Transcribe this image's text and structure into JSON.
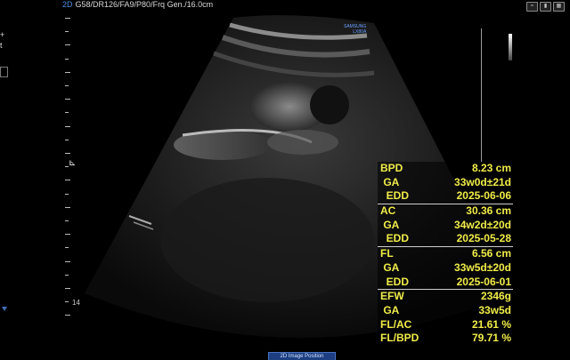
{
  "header": {
    "mode": "2D",
    "params": "G58/DR126/FA9/P80/Frq Gen./16.0cm"
  },
  "brand": {
    "line1": "SAMSUNG",
    "line2": "LX80A"
  },
  "scale": {
    "depth_label": "14"
  },
  "measurements": [
    {
      "label": "BPD",
      "value": "8.23 cm"
    },
    {
      "label": " GA",
      "value": "33w0d±21d"
    },
    {
      "label": "  EDD",
      "value": "2025-06-06"
    },
    {
      "label": "AC",
      "value": "30.36 cm"
    },
    {
      "label": " GA",
      "value": "34w2d±20d"
    },
    {
      "label": "  EDD",
      "value": "2025-05-28"
    },
    {
      "label": "FL",
      "value": "6.56 cm"
    },
    {
      "label": " GA",
      "value": "33w5d±20d"
    },
    {
      "label": "  EDD",
      "value": "2025-06-01"
    },
    {
      "label": "EFW",
      "value": "2346g"
    },
    {
      "label": " GA",
      "value": "33w5d"
    },
    {
      "label": "FL/AC",
      "value": "21.61 %"
    },
    {
      "label": "FL/BPD",
      "value": "79.71 %"
    }
  ],
  "bottom_tab": {
    "label": "2D Image Position"
  },
  "colors": {
    "measurement_text": "#f0ec4a",
    "accent_blue": "#4f8fe0",
    "background": "#000000"
  },
  "left_controls": {
    "plus": "+",
    "t_label": "t"
  }
}
